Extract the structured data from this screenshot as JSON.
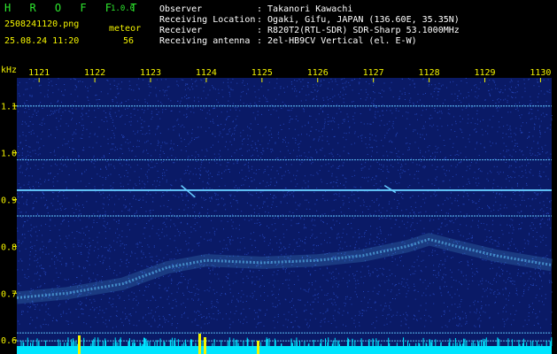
{
  "header": {
    "app_name": "H R O F F T",
    "version": "1.0.0",
    "filename": "2508241120.png",
    "mode_label": "meteor",
    "datetime": "25.08.24 11:20",
    "count": "56",
    "fields": [
      {
        "label": "Observer",
        "value": ": Takanori Kawachi"
      },
      {
        "label": "Receiving Location",
        "value": ": Ogaki, Gifu, JAPAN (136.60E, 35.35N)"
      },
      {
        "label": "Receiver",
        "value": ": R820T2(RTL-SDR) SDR-Sharp 53.1000MHz"
      },
      {
        "label": "Receiving antenna",
        "value": ": 2el-HB9CV Vertical (el. E-W)"
      }
    ]
  },
  "colors": {
    "background": "#000000",
    "spectrum_bg": "#0a1a66",
    "noise": "#3a6bff",
    "signal": "#66ccff",
    "axis_text": "#f4f400",
    "title_green": "#2ee82e",
    "level_bar": "#00e5ff",
    "level_peak": "#f4f400"
  },
  "chart_data": {
    "type": "heatmap",
    "ylabel": "kHz",
    "x_ticks": [
      "1121",
      "1122",
      "1123",
      "1124",
      "1125",
      "1126",
      "1127",
      "1128",
      "1129",
      "1130"
    ],
    "x_range": [
      1120.6,
      1130.2
    ],
    "y_ticks": [
      "1.1",
      "1.0",
      "0.9",
      "0.8",
      "0.7",
      "0.6"
    ],
    "y_range": [
      0.57,
      1.16
    ],
    "carriers_khz": [
      1.1,
      0.985,
      0.92,
      0.865,
      0.615,
      0.598
    ],
    "drift_trace": {
      "x": [
        1120.6,
        1121.5,
        1122.5,
        1123.3,
        1124.0,
        1125.0,
        1126.0,
        1126.8,
        1127.6,
        1128.0,
        1128.5,
        1129.2,
        1130.2
      ],
      "y": [
        0.69,
        0.7,
        0.72,
        0.755,
        0.77,
        0.765,
        0.77,
        0.78,
        0.8,
        0.815,
        0.8,
        0.78,
        0.76
      ]
    },
    "meteor_pings": [
      {
        "x": [
          1123.55,
          1123.8
        ],
        "y": [
          0.93,
          0.905
        ]
      },
      {
        "x": [
          1127.2,
          1127.4
        ],
        "y": [
          0.93,
          0.915
        ]
      }
    ]
  }
}
